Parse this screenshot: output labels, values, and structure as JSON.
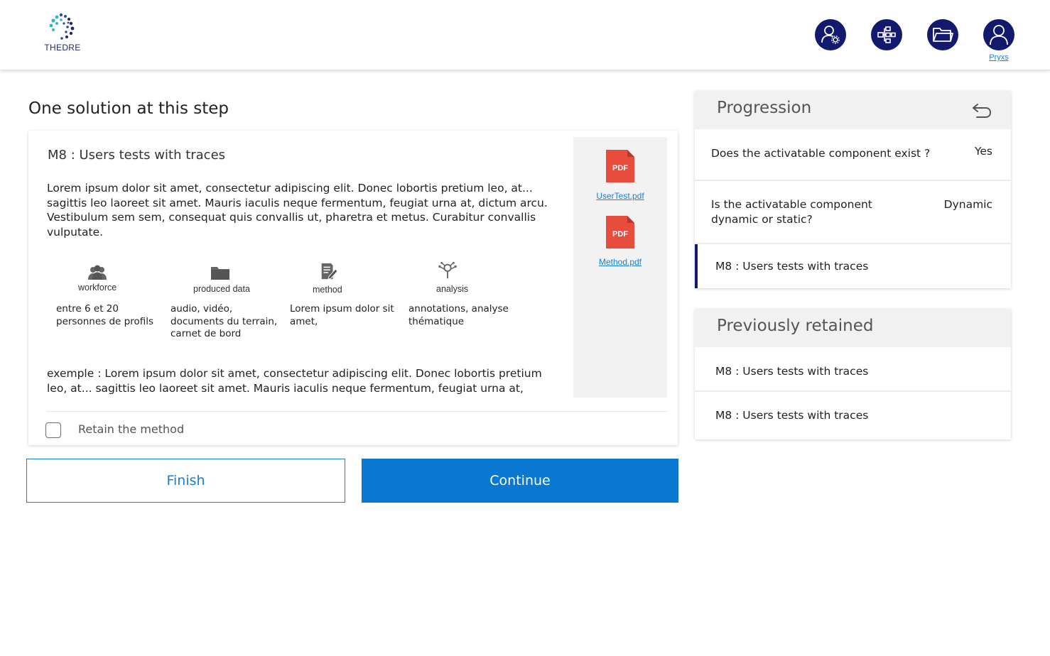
{
  "header": {
    "logo_text": "THEDRE",
    "icons": [
      "user-settings-icon",
      "hierarchy-icon",
      "folder-icon",
      "user-icon"
    ],
    "user_name": "Pryxs",
    "accent_color": "#131a6e"
  },
  "main": {
    "title": "One solution at this step",
    "card": {
      "title": "M8 : Users tests with traces",
      "description": "Lorem ipsum dolor sit amet, consectetur adipiscing elit. Donec lobortis pretium leo, at... sagittis leo laoreet sit amet. Mauris iaculis neque fermentum, feugiat urna at, dictum arcu. Vestibulum sem sem, consequat quis convallis ut, pharetra et metus. Curabitur convallis vulputate.",
      "attributes": [
        {
          "label": "workforce",
          "value": "entre 6 et 20 personnes de profils",
          "icon": "people-icon"
        },
        {
          "label": "produced data",
          "value": "audio, vidéo, documents du terrain, carnet de bord",
          "icon": "folder-icon"
        },
        {
          "label": "method",
          "value": "Lorem ipsum dolor sit amet,",
          "icon": "edit-document-icon"
        },
        {
          "label": "analysis",
          "value": "annotations, analyse thématique",
          "icon": "analysis-icon"
        }
      ],
      "example": "exemple : Lorem ipsum dolor sit amet, consectetur adipiscing elit. Donec lobortis pretium leo, at... sagittis leo laoreet sit amet. Mauris iaculis neque fermentum, feugiat urna at,",
      "files": [
        {
          "badge": "PDF",
          "name": "UserTest.pdf"
        },
        {
          "badge": "PDF",
          "name": "Method.pdf"
        }
      ],
      "checkbox_label": "Retain the method",
      "checkbox_checked": false
    },
    "buttons": {
      "finish": "Finish",
      "continue": "Continue"
    }
  },
  "progression": {
    "title": "Progression",
    "rows": [
      {
        "question": "Does the activatable component exist ?",
        "answer": "Yes"
      },
      {
        "question": "Is the activatable component dynamic or static?",
        "answer": "Dynamic"
      }
    ],
    "current": "M8 : Users tests with traces"
  },
  "retained": {
    "title": "Previously retained",
    "items": [
      "M8 : Users tests with traces",
      "M8 : Users tests with traces"
    ]
  },
  "colors": {
    "primary": "#0a78d0",
    "navy": "#131a6e",
    "pdf_red": "#e84c3d"
  }
}
